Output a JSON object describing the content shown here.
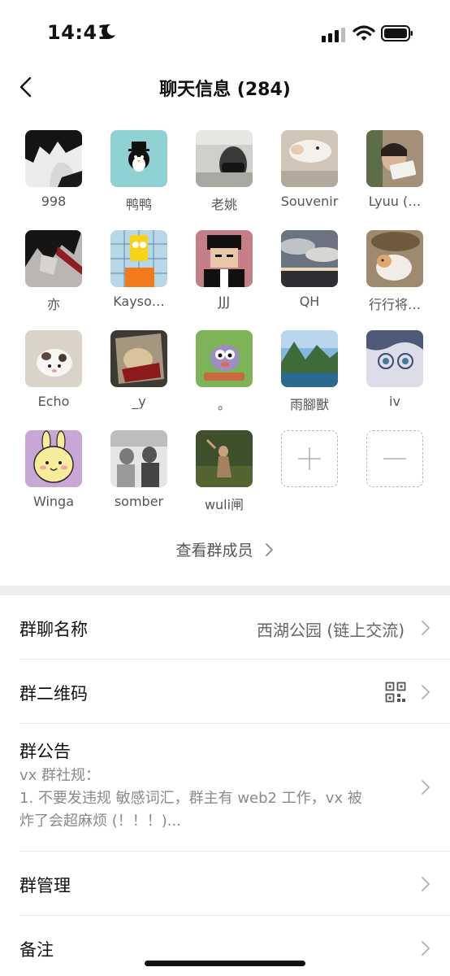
{
  "status": {
    "time": "14:41"
  },
  "nav": {
    "title": "聊天信息 (284)"
  },
  "members": [
    {
      "name": "998"
    },
    {
      "name": "鸭鸭"
    },
    {
      "name": "老姚"
    },
    {
      "name": "Souvenir"
    },
    {
      "name": "Lyuu (…"
    },
    {
      "name": "亦"
    },
    {
      "name": "Kayso…"
    },
    {
      "name": "JJJ"
    },
    {
      "name": "QH"
    },
    {
      "name": "行行将…"
    },
    {
      "name": "Echo"
    },
    {
      "name": "_y"
    },
    {
      "name": "。"
    },
    {
      "name": "雨腳獸"
    },
    {
      "name": "iv"
    },
    {
      "name": "Winga"
    },
    {
      "name": "somber"
    },
    {
      "name": "wuli闸"
    }
  ],
  "view_members": "查看群成员",
  "settings": {
    "group_name": {
      "label": "群聊名称",
      "value": "西湖公园 (链上交流)"
    },
    "qr": {
      "label": "群二维码"
    },
    "notice": {
      "label": "群公告",
      "line1": "vx 群社规：",
      "line2": "1. 不要发违规 敏感词汇，群主有 web2 工作，vx 被",
      "line3": "炸了会超麻烦 (！！！)..."
    },
    "manage": {
      "label": "群管理"
    },
    "remark": {
      "label": "备注"
    }
  }
}
